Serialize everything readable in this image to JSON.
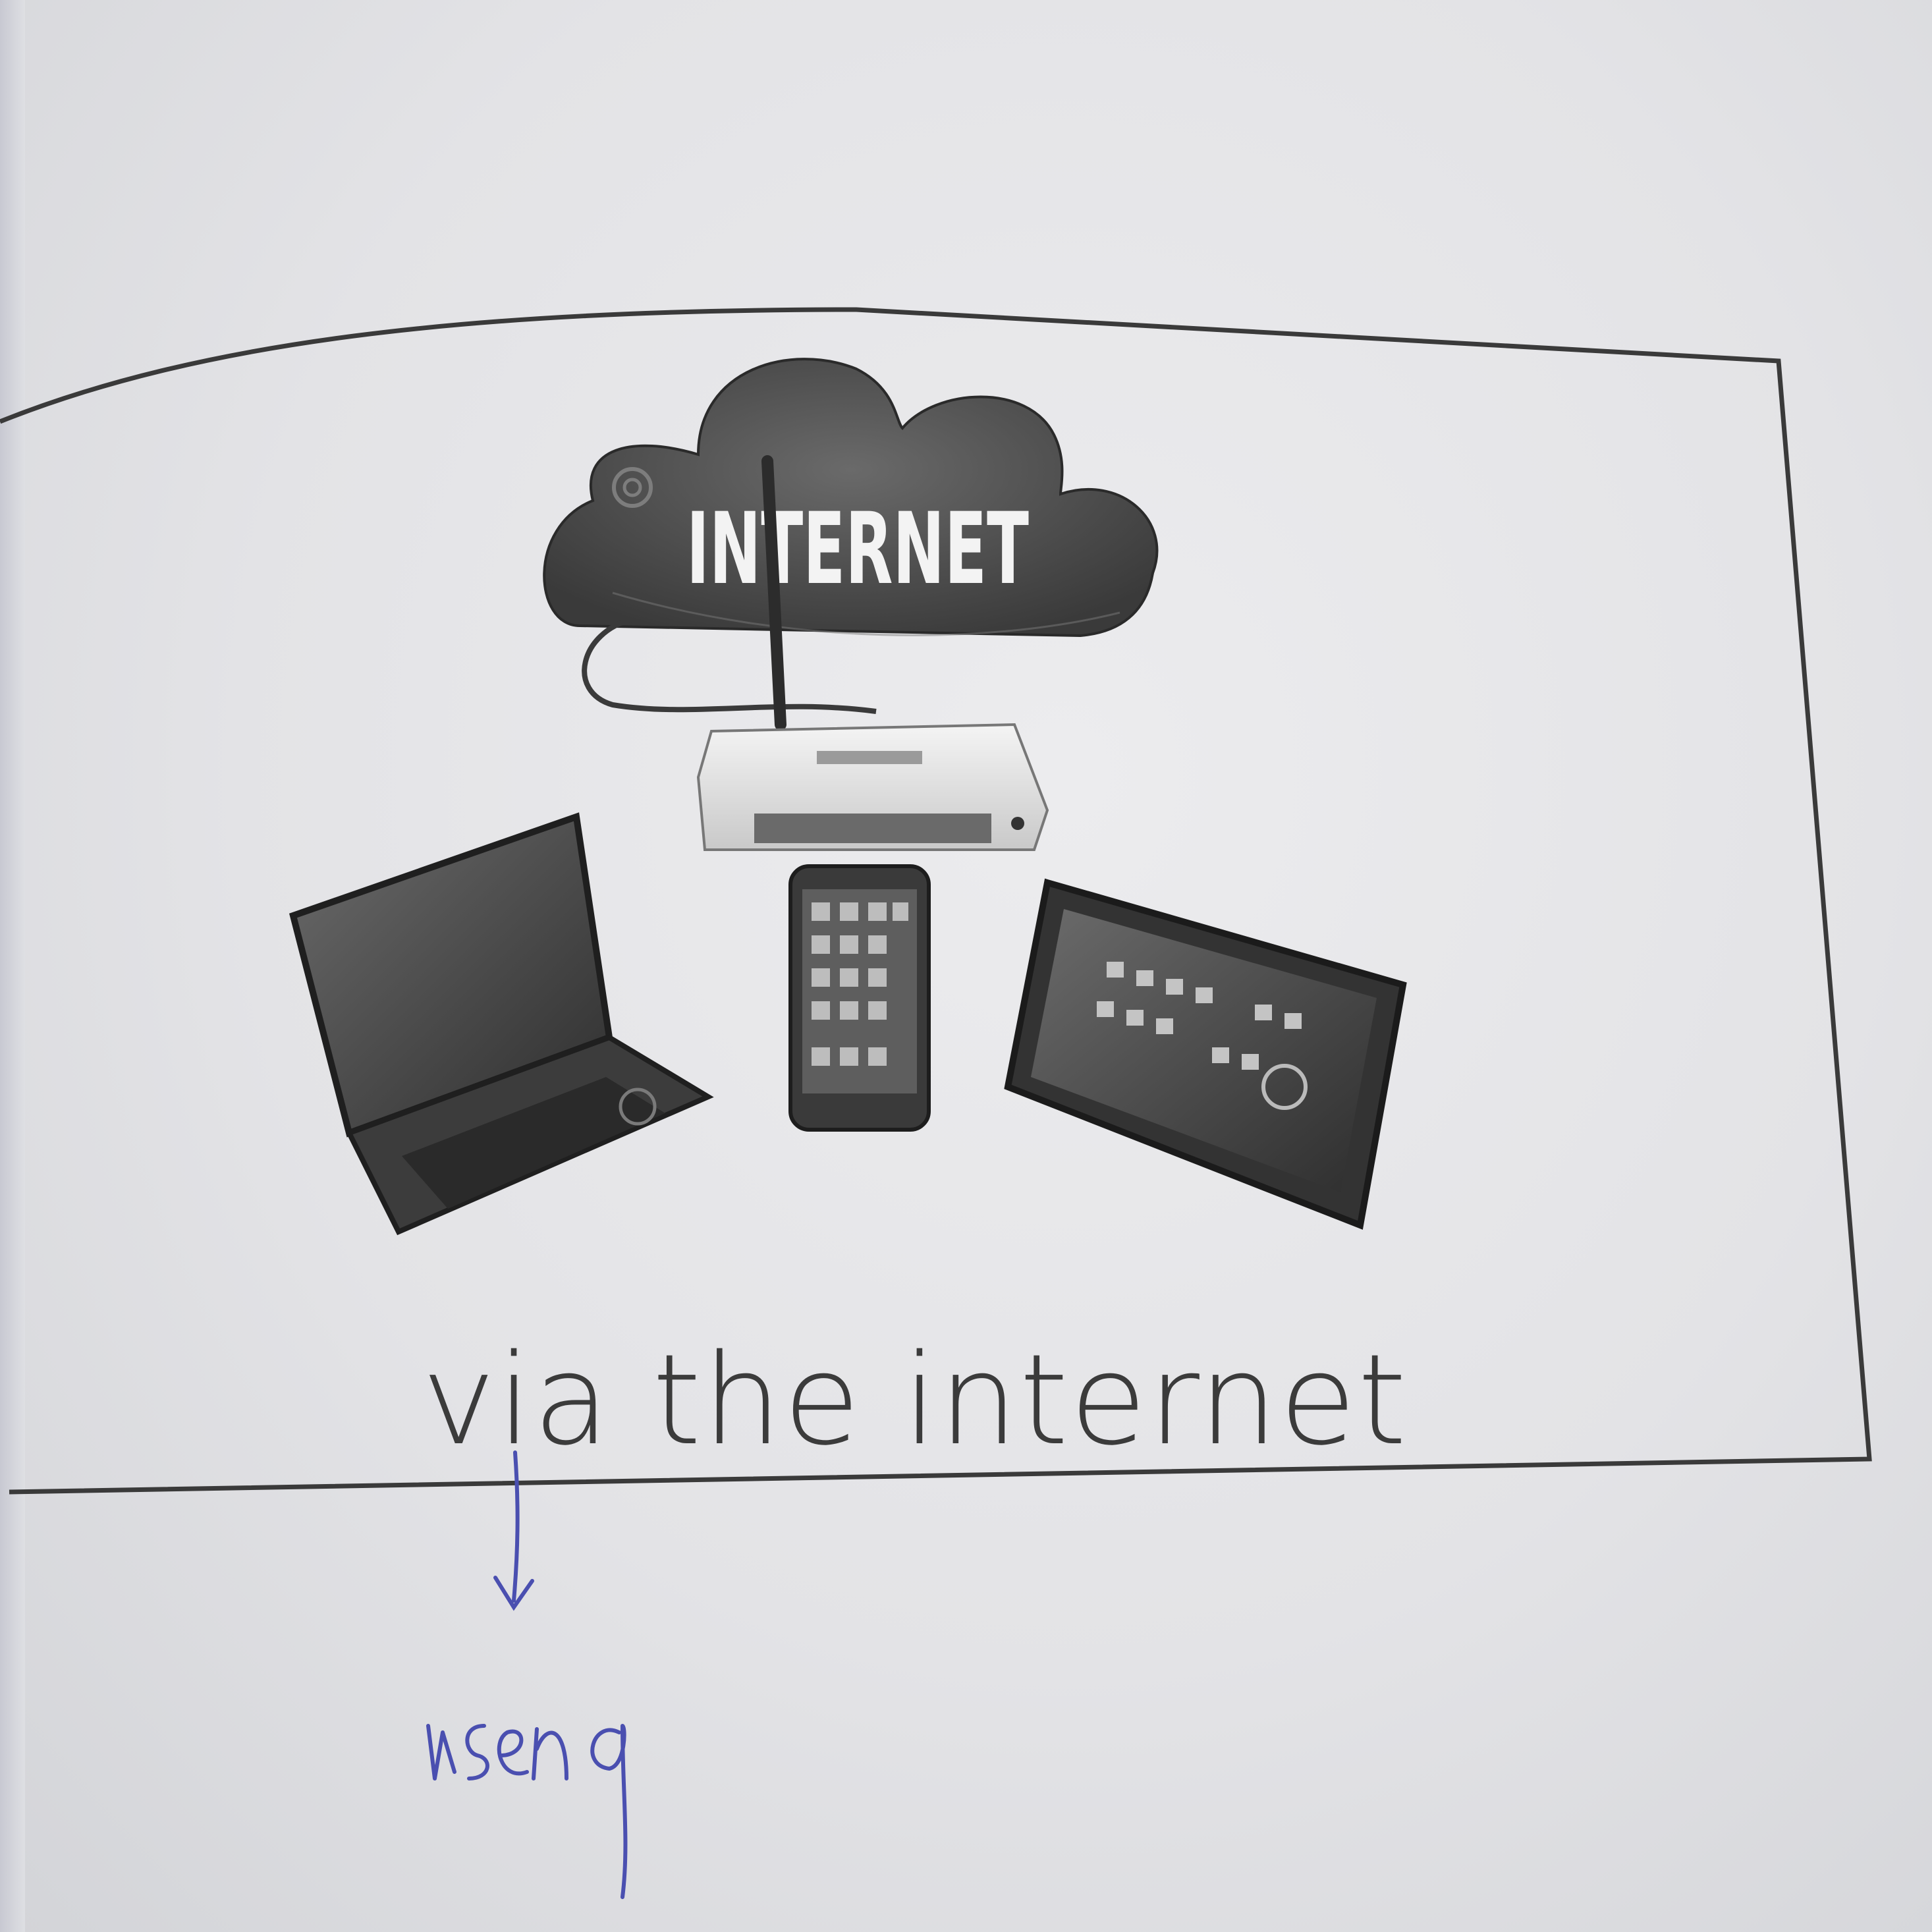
{
  "illustration": {
    "cloud_label": "INTERNET",
    "devices": [
      "laptop",
      "smartphone",
      "tablet"
    ],
    "router": "wireless-router"
  },
  "caption": "via the internet",
  "annotation": {
    "arrow": "down-arrow-icon",
    "handwritten_note": "using",
    "ink_color": "#4a4fb0"
  }
}
